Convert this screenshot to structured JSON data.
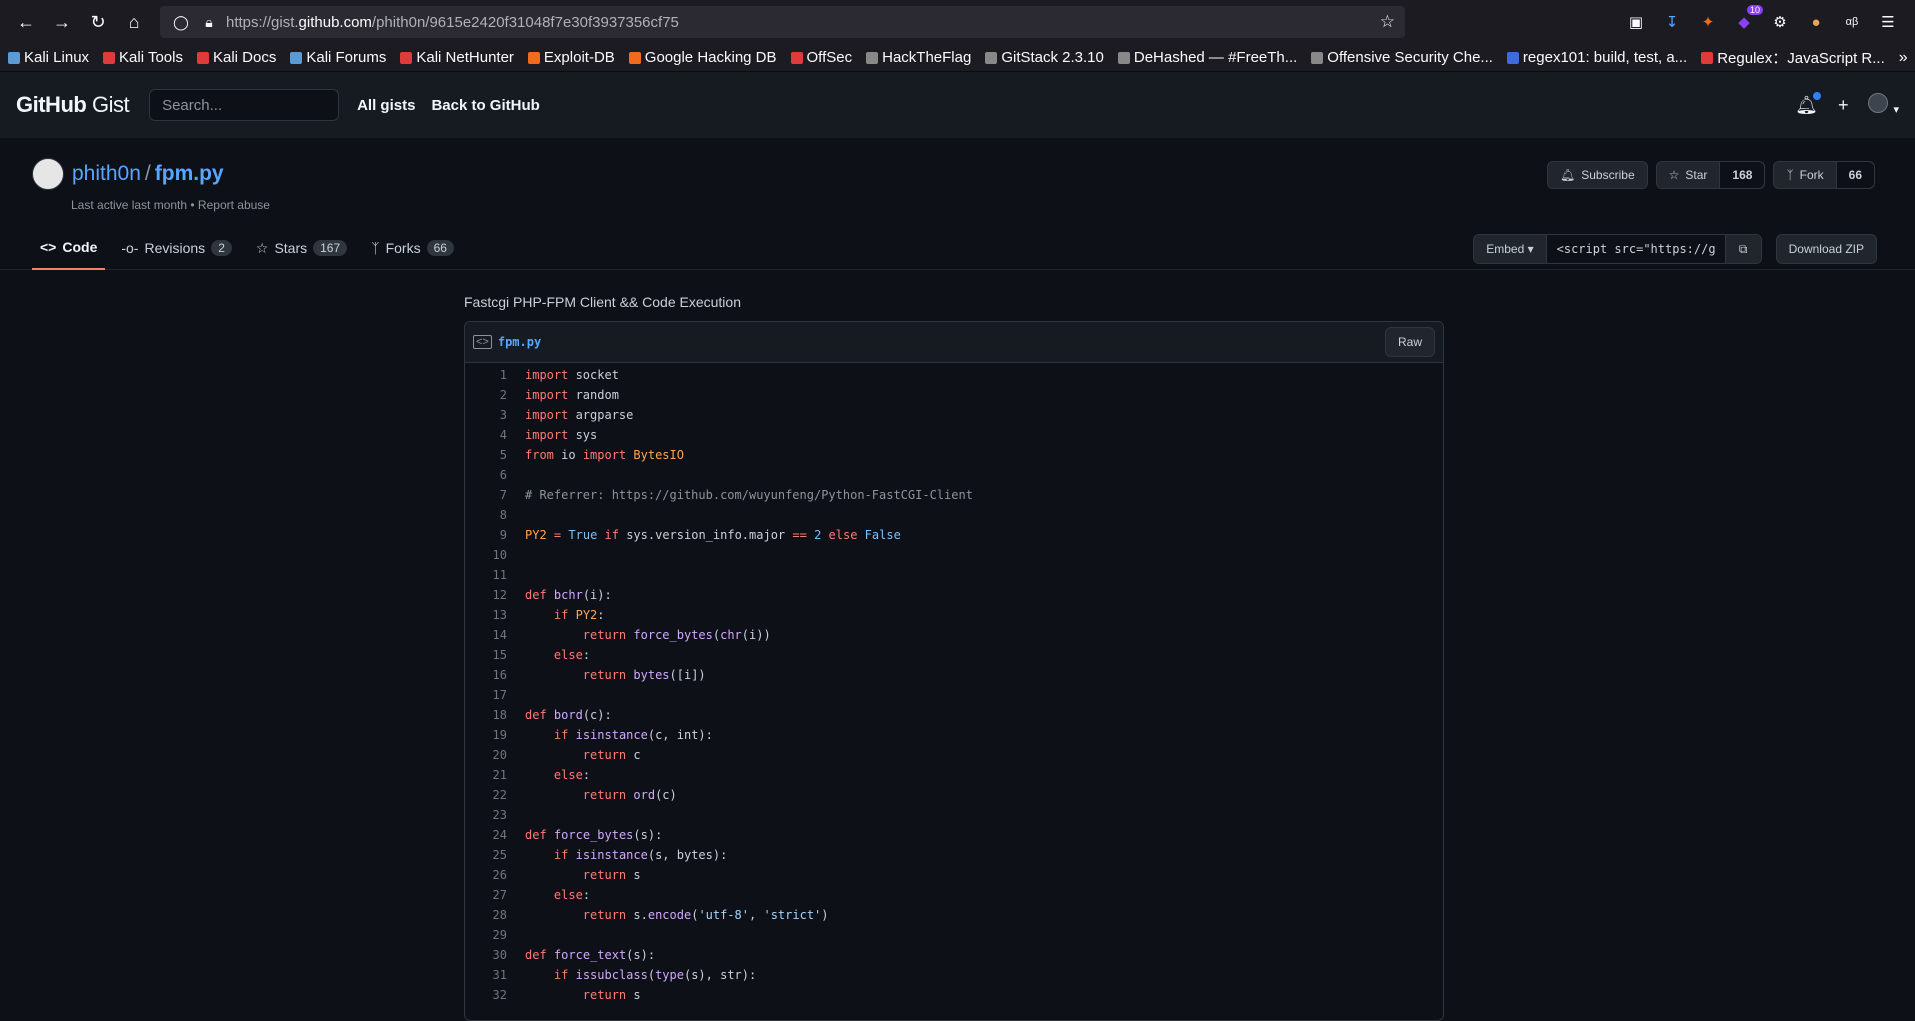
{
  "browser": {
    "url_prefix": "https://gist.",
    "url_domain": "github.com",
    "url_path": "/phith0n/9615e2420f31048f7e30f3937356cf75",
    "ext_badge": "10",
    "bookmarks": [
      {
        "label": "Kali Linux",
        "color": "#5a9bd5"
      },
      {
        "label": "Kali Tools",
        "color": "#e03b3b"
      },
      {
        "label": "Kali Docs",
        "color": "#e03b3b"
      },
      {
        "label": "Kali Forums",
        "color": "#5a9bd5"
      },
      {
        "label": "Kali NetHunter",
        "color": "#e03b3b"
      },
      {
        "label": "Exploit-DB",
        "color": "#f26b1d"
      },
      {
        "label": "Google Hacking DB",
        "color": "#f26b1d"
      },
      {
        "label": "OffSec",
        "color": "#e03b3b"
      },
      {
        "label": "HackTheFlag",
        "color": "#888888"
      },
      {
        "label": "GitStack 2.3.10",
        "color": "#888888"
      },
      {
        "label": "DeHashed — #FreeTh...",
        "color": "#888888"
      },
      {
        "label": "Offensive Security Che...",
        "color": "#888888"
      },
      {
        "label": "regex101: build, test, a...",
        "color": "#3b6de0"
      },
      {
        "label": "Regulex：JavaScript R...",
        "color": "#e03b3b"
      }
    ]
  },
  "header": {
    "logo_bold": "GitHub",
    "logo_light": "Gist",
    "search_placeholder": "Search...",
    "all_gists": "All gists",
    "back": "Back to GitHub"
  },
  "gist": {
    "owner": "phith0n",
    "filename_title": "fpm.py",
    "meta": "Last active last month • Report abuse",
    "subscribe": "Subscribe",
    "star": "Star",
    "star_count": "168",
    "fork": "Fork",
    "fork_count": "66",
    "tabs": [
      {
        "label": "Code",
        "count": ""
      },
      {
        "label": "Revisions",
        "count": "2"
      },
      {
        "label": "Stars",
        "count": "167"
      },
      {
        "label": "Forks",
        "count": "66"
      }
    ],
    "embed": "Embed",
    "embed_value": "<script src=\"https://g",
    "download": "Download ZIP",
    "description": "Fastcgi PHP-FPM Client && Code Execution",
    "file_name": "fpm.py",
    "raw": "Raw"
  },
  "code_lines": [
    [
      [
        "kw",
        "import"
      ],
      [
        "txt",
        " socket"
      ]
    ],
    [
      [
        "kw",
        "import"
      ],
      [
        "txt",
        " random"
      ]
    ],
    [
      [
        "kw",
        "import"
      ],
      [
        "txt",
        " argparse"
      ]
    ],
    [
      [
        "kw",
        "import"
      ],
      [
        "txt",
        " sys"
      ]
    ],
    [
      [
        "kw",
        "from"
      ],
      [
        "txt",
        " io "
      ],
      [
        "kw",
        "import"
      ],
      [
        "txt",
        " "
      ],
      [
        "cl",
        "BytesIO"
      ]
    ],
    [],
    [
      [
        "cm",
        "# Referrer: https://github.com/wuyunfeng/Python-FastCGI-Client"
      ]
    ],
    [],
    [
      [
        "cl",
        "PY2"
      ],
      [
        "txt",
        " "
      ],
      [
        "kw",
        "="
      ],
      [
        "txt",
        " "
      ],
      [
        "nb",
        "True"
      ],
      [
        "txt",
        " "
      ],
      [
        "kw",
        "if"
      ],
      [
        "txt",
        " sys.version_info.major "
      ],
      [
        "kw",
        "=="
      ],
      [
        "txt",
        " "
      ],
      [
        "nb",
        "2"
      ],
      [
        "txt",
        " "
      ],
      [
        "kw",
        "else"
      ],
      [
        "txt",
        " "
      ],
      [
        "nb",
        "False"
      ]
    ],
    [],
    [],
    [
      [
        "kw",
        "def"
      ],
      [
        "txt",
        " "
      ],
      [
        "fn",
        "bchr"
      ],
      [
        "txt",
        "(i):"
      ]
    ],
    [
      [
        "txt",
        "    "
      ],
      [
        "kw",
        "if"
      ],
      [
        "txt",
        " "
      ],
      [
        "cl",
        "PY2"
      ],
      [
        "txt",
        ":"
      ]
    ],
    [
      [
        "txt",
        "        "
      ],
      [
        "kw",
        "return"
      ],
      [
        "txt",
        " "
      ],
      [
        "fn",
        "force_bytes"
      ],
      [
        "txt",
        "("
      ],
      [
        "fn",
        "chr"
      ],
      [
        "txt",
        "(i))"
      ]
    ],
    [
      [
        "txt",
        "    "
      ],
      [
        "kw",
        "else"
      ],
      [
        "txt",
        ":"
      ]
    ],
    [
      [
        "txt",
        "        "
      ],
      [
        "kw",
        "return"
      ],
      [
        "txt",
        " "
      ],
      [
        "fn",
        "bytes"
      ],
      [
        "txt",
        "([i])"
      ]
    ],
    [],
    [
      [
        "kw",
        "def"
      ],
      [
        "txt",
        " "
      ],
      [
        "fn",
        "bord"
      ],
      [
        "txt",
        "(c):"
      ]
    ],
    [
      [
        "txt",
        "    "
      ],
      [
        "kw",
        "if"
      ],
      [
        "txt",
        " "
      ],
      [
        "fn",
        "isinstance"
      ],
      [
        "txt",
        "(c, int):"
      ]
    ],
    [
      [
        "txt",
        "        "
      ],
      [
        "kw",
        "return"
      ],
      [
        "txt",
        " c"
      ]
    ],
    [
      [
        "txt",
        "    "
      ],
      [
        "kw",
        "else"
      ],
      [
        "txt",
        ":"
      ]
    ],
    [
      [
        "txt",
        "        "
      ],
      [
        "kw",
        "return"
      ],
      [
        "txt",
        " "
      ],
      [
        "fn",
        "ord"
      ],
      [
        "txt",
        "(c)"
      ]
    ],
    [],
    [
      [
        "kw",
        "def"
      ],
      [
        "txt",
        " "
      ],
      [
        "fn",
        "force_bytes"
      ],
      [
        "txt",
        "(s):"
      ]
    ],
    [
      [
        "txt",
        "    "
      ],
      [
        "kw",
        "if"
      ],
      [
        "txt",
        " "
      ],
      [
        "fn",
        "isinstance"
      ],
      [
        "txt",
        "(s, bytes):"
      ]
    ],
    [
      [
        "txt",
        "        "
      ],
      [
        "kw",
        "return"
      ],
      [
        "txt",
        " s"
      ]
    ],
    [
      [
        "txt",
        "    "
      ],
      [
        "kw",
        "else"
      ],
      [
        "txt",
        ":"
      ]
    ],
    [
      [
        "txt",
        "        "
      ],
      [
        "kw",
        "return"
      ],
      [
        "txt",
        " s."
      ],
      [
        "fn",
        "encode"
      ],
      [
        "txt",
        "("
      ],
      [
        "st",
        "'utf-8'"
      ],
      [
        "txt",
        ", "
      ],
      [
        "st",
        "'strict'"
      ],
      [
        "txt",
        ")"
      ]
    ],
    [],
    [
      [
        "kw",
        "def"
      ],
      [
        "txt",
        " "
      ],
      [
        "fn",
        "force_text"
      ],
      [
        "txt",
        "(s):"
      ]
    ],
    [
      [
        "txt",
        "    "
      ],
      [
        "kw",
        "if"
      ],
      [
        "txt",
        " "
      ],
      [
        "fn",
        "issubclass"
      ],
      [
        "txt",
        "("
      ],
      [
        "fn",
        "type"
      ],
      [
        "txt",
        "(s), str):"
      ]
    ],
    [
      [
        "txt",
        "        "
      ],
      [
        "kw",
        "return"
      ],
      [
        "txt",
        " s"
      ]
    ]
  ]
}
